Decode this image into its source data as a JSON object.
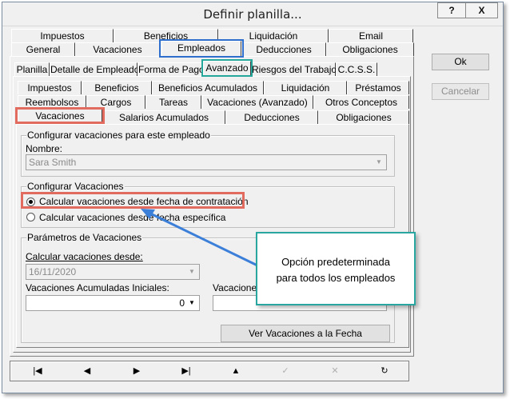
{
  "window": {
    "title": "Definir planilla...",
    "help_label": "?",
    "close_label": "X"
  },
  "tabs_main": {
    "row1": [
      "Impuestos",
      "Beneficios",
      "Liquidación",
      "Email"
    ],
    "row2": [
      "General",
      "Vacaciones",
      "Empleados",
      "Deducciones",
      "Obligaciones"
    ],
    "selected": "Empleados"
  },
  "tabs_employee": {
    "items": [
      "Planilla",
      "Detalle de Empleado",
      "Forma de Pago",
      "Avanzado",
      "Riesgos del Trabajo",
      "C.C.S.S."
    ],
    "selected": "Avanzado"
  },
  "tabs_advanced": {
    "row1": [
      "Impuestos",
      "Beneficios",
      "Beneficios Acumulados",
      "Liquidación",
      "Préstamos"
    ],
    "row2": [
      "Reembolsos",
      "Cargos",
      "Tareas",
      "Vacaciones (Avanzado)",
      "Otros Conceptos"
    ],
    "row3": [
      "Vacaciones",
      "Salarios Acumulados",
      "Deducciones",
      "Obligaciones"
    ],
    "selected": "Vacaciones"
  },
  "group_config_employee": {
    "title": "Configurar vacaciones para este empleado",
    "name_label": "Nombre:",
    "name_value": "Sara Smith"
  },
  "group_config_vac": {
    "title": "Configurar Vacaciones",
    "option1": "Calcular vacaciones desde fecha de contratación",
    "option2": "Calcular vacaciones desde fecha específica",
    "selected": "option1"
  },
  "group_params": {
    "title": "Parámetros de Vacaciones",
    "calc_from_label": "Calcular vacaciones desde:",
    "calc_from_value": "16/11/2020",
    "initial_label": "Vacaciones Acumuladas Iniciales:",
    "initial_value": "0",
    "second_label": "Vacaciones",
    "view_button": "Ver Vacaciones a la Fecha"
  },
  "side_buttons": {
    "ok": "Ok",
    "cancel": "Cancelar"
  },
  "navbar": {
    "first": "|◀",
    "prev": "◀",
    "next": "▶",
    "last": "▶|",
    "up": "▲",
    "check": "✓",
    "cancel": "✕",
    "refresh": "↻"
  },
  "callout": {
    "text": "Opción predeterminada para todos los empleados"
  },
  "colors": {
    "blue_highlight": "#2e6fce",
    "teal_highlight": "#25a79c",
    "red_highlight": "#e06b5e",
    "arrow": "#3b7fd9"
  }
}
